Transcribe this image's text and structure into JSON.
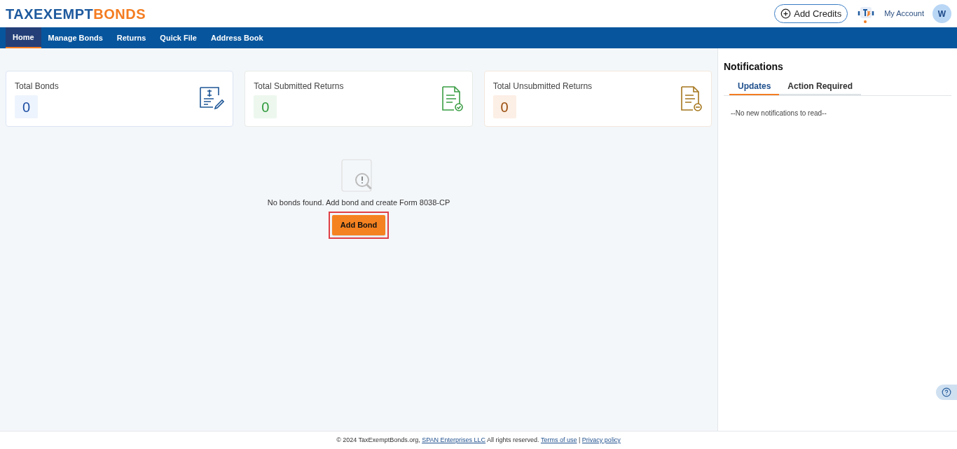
{
  "header": {
    "logo": {
      "part_1": "TAXEXEMPT",
      "part_2": "BONDS"
    },
    "add_credits": "Add Credits",
    "account": "My Account",
    "avatar": "W"
  },
  "nav": [
    {
      "label": "Home",
      "selected": true
    },
    {
      "label": "Manage Bonds",
      "selected": false
    },
    {
      "label": "Returns",
      "selected": false
    },
    {
      "label": "Quick File",
      "selected": false
    },
    {
      "label": "Address Book",
      "selected": false
    }
  ],
  "stats": [
    {
      "kind": "bonds",
      "label": "Total Bonds",
      "value": "0"
    },
    {
      "kind": "submitted",
      "label": "Total Submitted Returns",
      "value": "0"
    },
    {
      "kind": "unsubmitted",
      "label": "Total Unsubmitted Returns",
      "value": "0"
    }
  ],
  "empty_state": {
    "message": "No bonds found. Add bond and create Form 8038-CP",
    "button": "Add Bond",
    "highlighted": true
  },
  "notifications": {
    "title": "Notifications",
    "tabs": [
      {
        "label": "Updates",
        "selected": true
      },
      {
        "label": "Action Required",
        "selected": false
      }
    ],
    "message": "--No new notifications to read--"
  },
  "footer": {
    "copyright": "© 2024 TaxExemptBonds.org,",
    "company_link": "SPAN Enterprises LLC",
    "rights": "All rights reserved.",
    "terms_link": "Terms of use",
    "separator": "|",
    "privacy_link": "Privacy policy"
  }
}
